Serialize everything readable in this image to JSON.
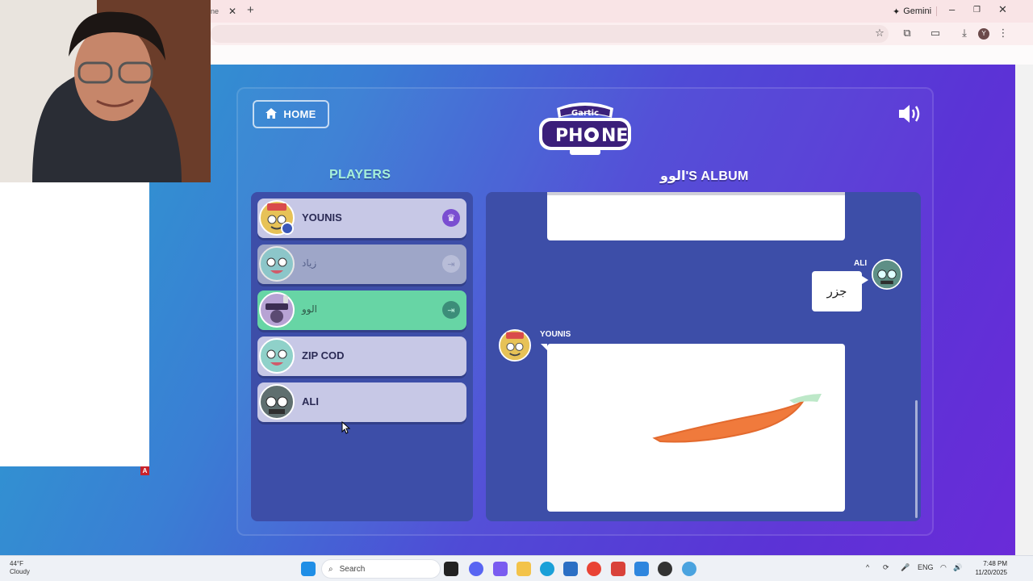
{
  "browser": {
    "tab_fragment": "ne",
    "gemini_label": "Gemini",
    "profile_initial": "Y"
  },
  "header": {
    "home_label": "HOME"
  },
  "players": {
    "title": "PLAYERS",
    "list": [
      {
        "name": "YOUNIS",
        "status": "host"
      },
      {
        "name": "زياد",
        "status": "left"
      },
      {
        "name": "الوو",
        "status": "active"
      },
      {
        "name": "ZIP COD",
        "status": ""
      },
      {
        "name": "ALI",
        "status": ""
      }
    ]
  },
  "album": {
    "title": "الوو'S ALBUM",
    "entries": [
      {
        "player": "ALI",
        "text": "جزر"
      },
      {
        "player": "YOUNIS",
        "drawing": "carrot"
      }
    ]
  },
  "taskbar": {
    "weather_temp": "44°F",
    "weather_desc": "Cloudy",
    "search_label": "Search",
    "lang": "ENG",
    "time": "7:48 PM",
    "date": "11/20/2025"
  },
  "overlay": {
    "badge_letter": "A"
  }
}
